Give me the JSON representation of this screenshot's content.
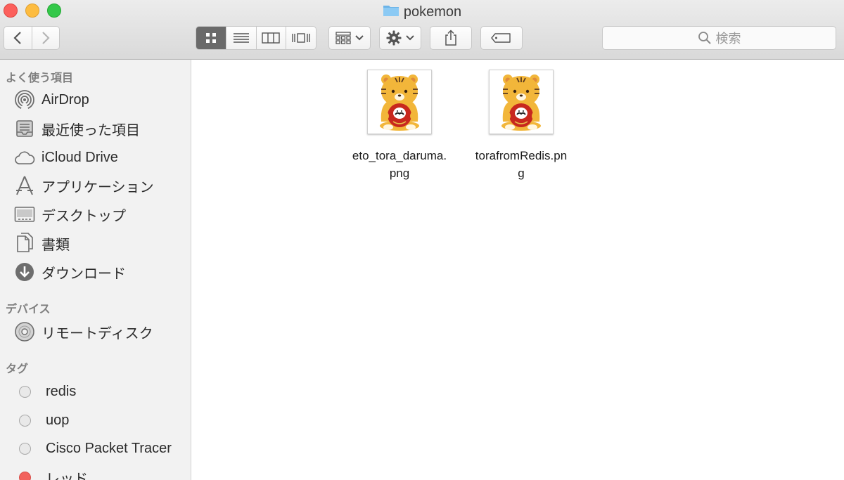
{
  "window": {
    "title": "pokemon"
  },
  "toolbar": {
    "back": "back",
    "forward": "forward",
    "views": [
      "icon",
      "list",
      "column",
      "cover-flow"
    ],
    "active_view": "icon",
    "search_placeholder": "検索"
  },
  "sidebar": {
    "favorites": {
      "header": "よく使う項目",
      "items": [
        {
          "label": "AirDrop",
          "icon": "airdrop-icon"
        },
        {
          "label": "最近使った項目",
          "icon": "recents-icon"
        },
        {
          "label": "iCloud Drive",
          "icon": "cloud-icon"
        },
        {
          "label": "アプリケーション",
          "icon": "applications-icon"
        },
        {
          "label": "デスクトップ",
          "icon": "desktop-icon"
        },
        {
          "label": "書類",
          "icon": "documents-icon"
        },
        {
          "label": "ダウンロード",
          "icon": "downloads-icon"
        }
      ]
    },
    "devices": {
      "header": "デバイス",
      "items": [
        {
          "label": "リモートディスク",
          "icon": "disc-icon"
        }
      ]
    },
    "tags": {
      "header": "タグ",
      "items": [
        {
          "label": "redis",
          "color": "#e9e9e9"
        },
        {
          "label": "uop",
          "color": "#e9e9e9"
        },
        {
          "label": "Cisco Packet Tracer",
          "color": "#e9e9e9"
        },
        {
          "label": "レッド",
          "color": "#f2625d"
        }
      ]
    }
  },
  "files": [
    {
      "name": "eto_tora_daruma.png",
      "name_lines": [
        "eto_tora_daruma.",
        "png"
      ]
    },
    {
      "name": "torafromRedis.png",
      "name_lines": [
        "torafromRedis.pn",
        "g"
      ]
    }
  ],
  "colors": {
    "selected_view": "#6a6a6a",
    "folder_blue": "#6cb4e8",
    "tiger_orange": "#f2b63a",
    "daruma_red": "#c8281e"
  }
}
